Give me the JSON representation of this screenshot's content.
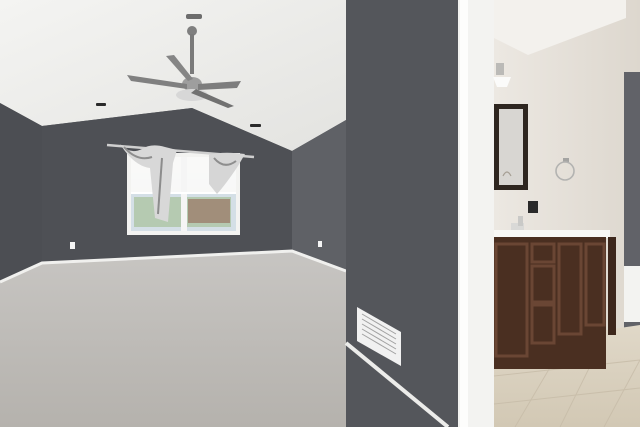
{
  "scene": {
    "kind": "photo",
    "palette": {
      "wall_dark": "#4b4d52",
      "wall_mid": "#5b5d62",
      "ceiling": "#e8e8e6",
      "carpet": "#bdbab5",
      "trim_white": "#f1f1ef",
      "cabinet_brown": "#4a2f21",
      "tile": "#d8d0bf",
      "bath_wall": "#e8e3dc"
    },
    "objects": [
      "ceiling-fan",
      "window",
      "curtain",
      "floor-vent",
      "vanity-cabinet",
      "mirror",
      "wall-light",
      "towel-ring",
      "doorway"
    ]
  }
}
